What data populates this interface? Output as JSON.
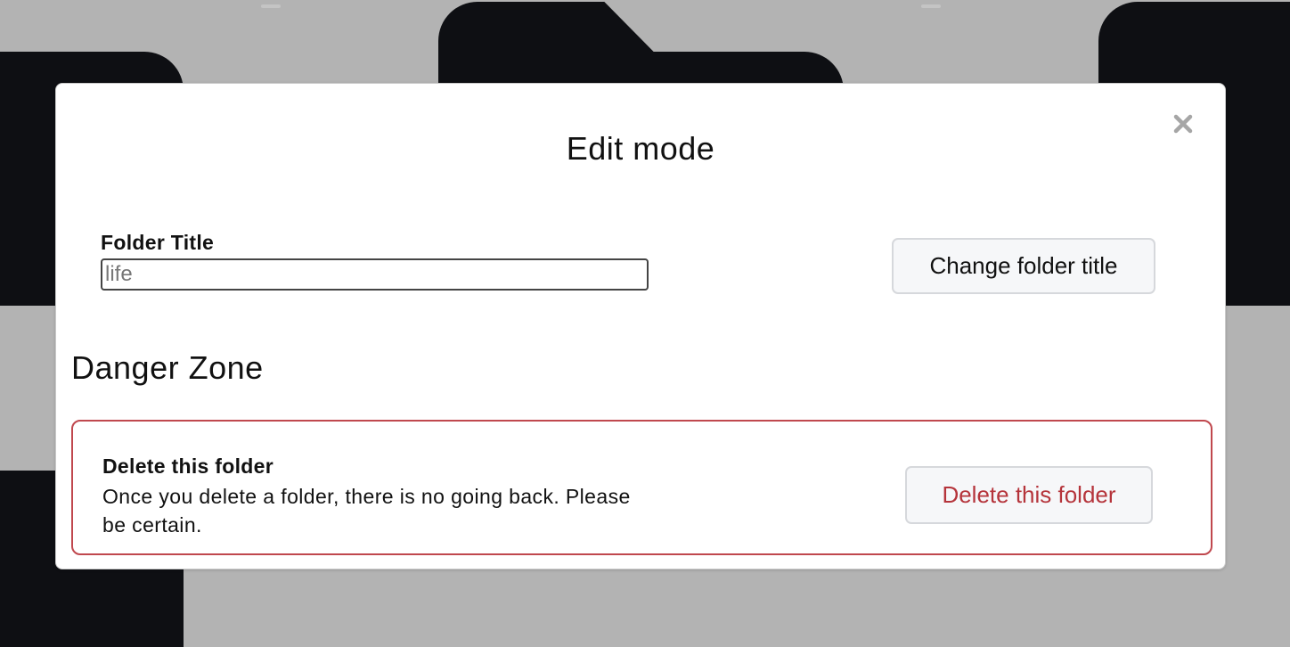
{
  "modal": {
    "title": "Edit mode",
    "close_icon": "close-icon"
  },
  "folder_title": {
    "label": "Folder Title",
    "placeholder": "life",
    "value": "",
    "button_label": "Change folder title"
  },
  "danger_zone": {
    "heading": "Danger Zone",
    "item_title": "Delete this folder",
    "description": "Once you delete a folder, there is no going back. Please be certain.",
    "button_label": "Delete this folder",
    "accent_color": "#c0484e"
  },
  "colors": {
    "backdrop": "#b3b3b3",
    "folder_dark": "#0e0f13",
    "danger_text": "#b5343b"
  }
}
